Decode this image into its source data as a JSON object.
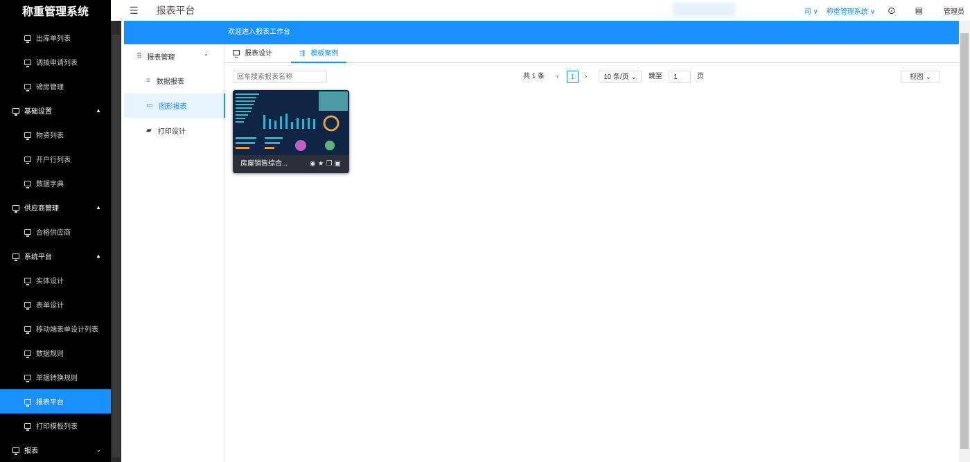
{
  "app": {
    "title": "称重管理系统"
  },
  "sidebar": {
    "items": [
      {
        "label": "出库单列表",
        "type": "sub"
      },
      {
        "label": "调拨申请列表",
        "type": "sub"
      },
      {
        "label": "磅房管理",
        "type": "sub"
      },
      {
        "label": "基础设置",
        "type": "grp",
        "chevron": "▲"
      },
      {
        "label": "物资列表",
        "type": "sub"
      },
      {
        "label": "开户行列表",
        "type": "sub"
      },
      {
        "label": "数据字典",
        "type": "sub"
      },
      {
        "label": "供应商管理",
        "type": "grp",
        "chevron": "▲"
      },
      {
        "label": "合格供应商",
        "type": "sub"
      },
      {
        "label": "系统平台",
        "type": "grp",
        "chevron": "▲"
      },
      {
        "label": "实体设计",
        "type": "sub"
      },
      {
        "label": "表单设计",
        "type": "sub"
      },
      {
        "label": "移动端表单设计列表",
        "type": "sub"
      },
      {
        "label": "数据规则",
        "type": "sub"
      },
      {
        "label": "单据转换规则",
        "type": "sub"
      },
      {
        "label": "报表平台",
        "type": "sub",
        "active": true
      },
      {
        "label": "打印模板列表",
        "type": "sub"
      },
      {
        "label": "报表",
        "type": "grp",
        "chevron": "⌄"
      }
    ]
  },
  "header": {
    "title": "报表平台",
    "org_partial": "司",
    "system": "称重管理系统",
    "user": "管理员"
  },
  "banner": {
    "text": "欢迎进入报表工作台"
  },
  "leftmenu": {
    "group": "报表管理",
    "items": [
      "数据报表",
      "图形报表",
      "打印设计"
    ]
  },
  "tabs": {
    "design": "报表设计",
    "templates": "模板案例"
  },
  "search": {
    "placeholder": "回车搜索报表名称"
  },
  "pager": {
    "total": "共 1 条",
    "page": "1",
    "size": "10 条/页",
    "jump": "跳至",
    "jump_value": "1",
    "page_suffix": "页",
    "view": "视图"
  },
  "cards": [
    {
      "title": "房屋销售综合..."
    }
  ],
  "colors": {
    "accent": "#1890ff",
    "sidebar": "#000000"
  }
}
